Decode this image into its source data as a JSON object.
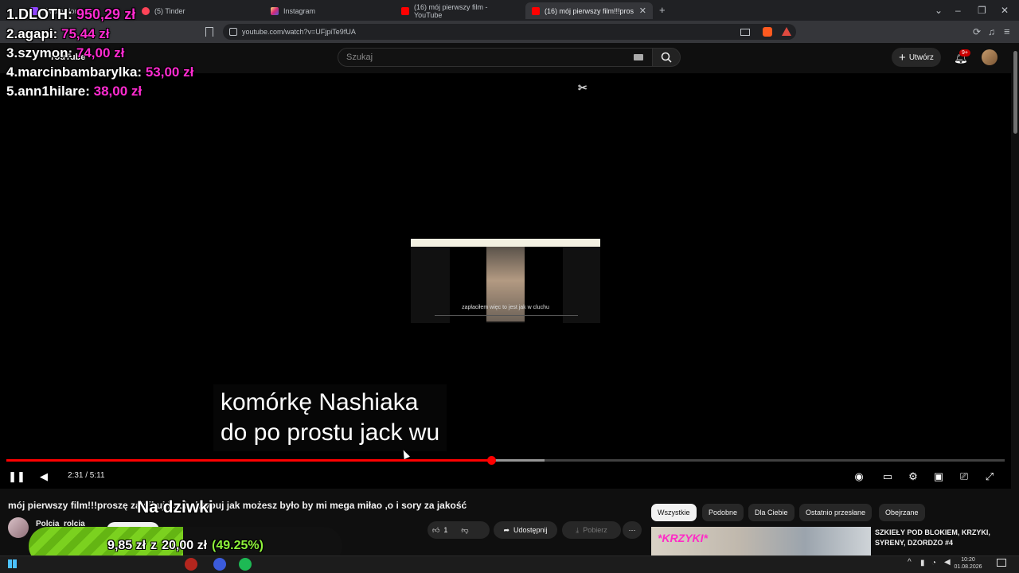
{
  "browser": {
    "tabs": [
      {
        "label": "Twitch Horse Gra",
        "favicon_color": "#9146ff",
        "active": false
      },
      {
        "label": "(5) Tinder",
        "favicon_color": "#ff4458",
        "active": false
      },
      {
        "label": "Instagram",
        "favicon_color": "#e1306c",
        "active": false
      },
      {
        "label": "(16) mój pierwszy film - YouTube",
        "favicon_color": "#ff0000",
        "active": false
      },
      {
        "label": "(16) mój pierwszy film!!!prosz",
        "favicon_color": "#ff0000",
        "active": true
      }
    ],
    "new_tab": "+",
    "url": "youtube.com/watch?v=UFjpiTe9fUA",
    "window_controls": [
      "⌄",
      "–",
      "❐",
      "✕"
    ]
  },
  "youtube": {
    "logo": "YouTube",
    "search_placeholder": "Szukaj",
    "create_label": "Utwórz",
    "notification_badge": "9+"
  },
  "player": {
    "inner_caption": "zapłaciłem więc to jest jak w cluchu",
    "subtitle_line1": "komórkę Nashiaka",
    "subtitle_line2": "do po prostu jack wu",
    "time": "2:31 / 5:11",
    "progress_fraction": 0.486,
    "buffered_fraction": 0.539
  },
  "video_info": {
    "title": "mój pierwszy film!!!proszę zalajkuj i subskrybuj jak możesz było by mi mega miłao ,o i sory za jakość",
    "channel": "Polcia_rolcia",
    "subscribe_label": "Subskrybuj",
    "like_count": "1",
    "share_label": "Udostępnij",
    "download_label": "Pobierz"
  },
  "recommendations": {
    "chips": [
      "Wszystkie",
      "Podobne",
      "Dla Ciebie",
      "Ostatnio przesłane",
      "Obejrzane"
    ],
    "first": {
      "thumb_text": "*KRZYKI*",
      "title": "SZKIEŁY POD BLOKIEM, KRZYKI, SYRENY, DZORDZO #4"
    }
  },
  "overlay": {
    "leaderboard": [
      {
        "rank": "1.",
        "name": "DLOTH:",
        "amount": "950,29 zł"
      },
      {
        "rank": "2.",
        "name": "agapi:",
        "amount": "75,44 zł"
      },
      {
        "rank": "3.",
        "name": "szymon:",
        "amount": "74,00 zł"
      },
      {
        "rank": "4.",
        "name": "marcinbambarylka:",
        "amount": "53,00 zł"
      },
      {
        "rank": "5.",
        "name": "ann1hilare:",
        "amount": "38,00 zł"
      }
    ],
    "goal": {
      "title": "Na dziwki",
      "current": "9,85 zł",
      "of": "z",
      "target": "20,00 zł",
      "percent": "(49.25%)",
      "fraction": 0.4925
    }
  },
  "taskbar": {
    "time": "10:20",
    "date": "01.08.2026"
  }
}
